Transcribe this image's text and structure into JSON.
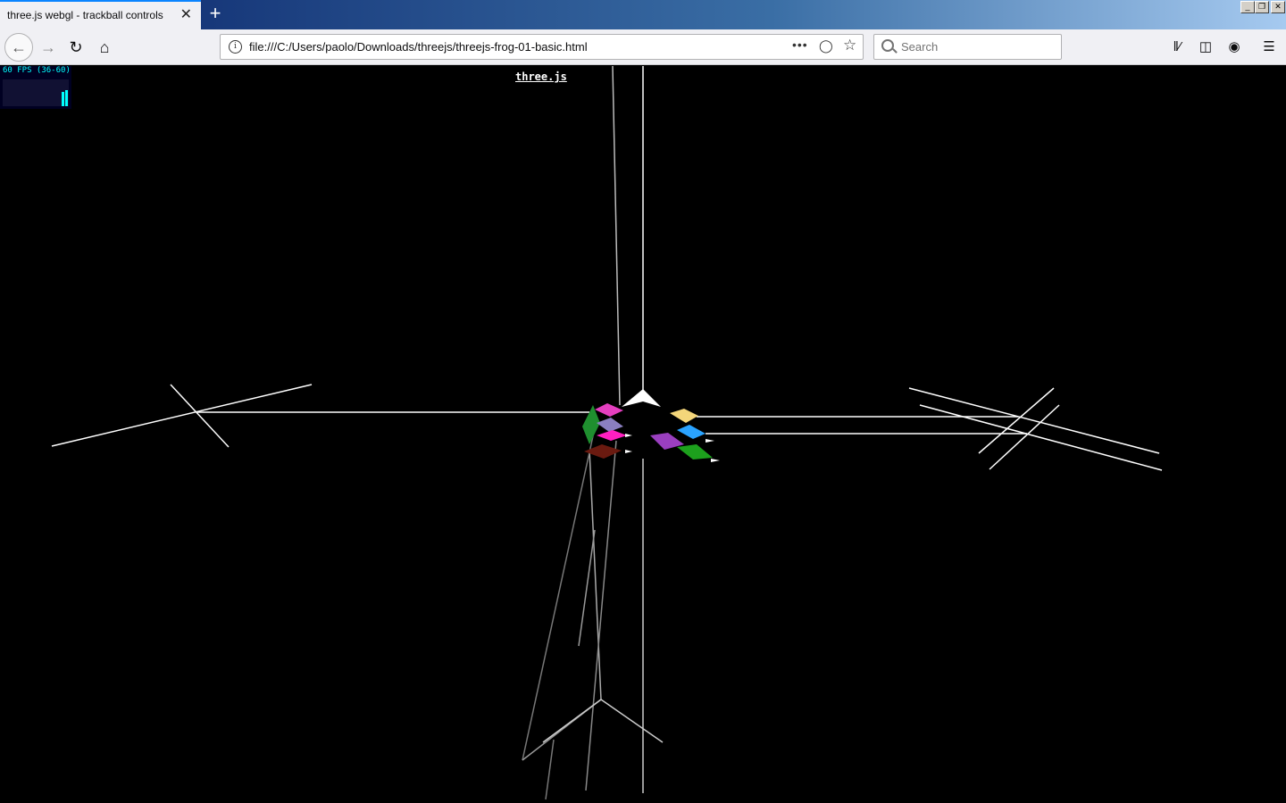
{
  "browser": {
    "tab_title": "three.js webgl - trackball controls",
    "tab_close": "✕",
    "new_tab": "+",
    "window_controls": [
      "_",
      "❐",
      "✕"
    ],
    "url": "file:///C:/Users/paolo/Downloads/threejs/threejs-frog-01-basic.html",
    "page_actions": "•••",
    "search_placeholder": "Search"
  },
  "icons": {
    "back": "back-arrow-icon",
    "forward": "forward-arrow-icon",
    "reload": "reload-icon",
    "home": "home-icon",
    "library": "library-icon",
    "sidebar": "sidebar-icon",
    "account": "account-icon",
    "menu": "hamburger-menu-icon"
  },
  "page": {
    "stats_text": "60 FPS (36-60)",
    "stats_fps": 60,
    "info_link": "three.js",
    "background": "#000000",
    "line_color": "#ffffff"
  }
}
